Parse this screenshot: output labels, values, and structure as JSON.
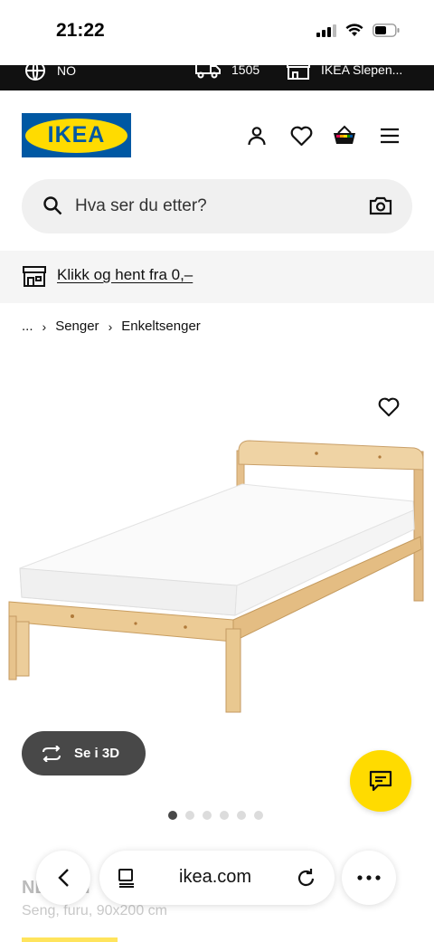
{
  "status_bar": {
    "time": "21:22"
  },
  "top_strip": {
    "items": [
      {
        "icon": "globe-icon",
        "label": "NO"
      },
      {
        "icon": "truck-icon",
        "label": "1505"
      },
      {
        "icon": "store-icon",
        "label": "IKEA Slepen..."
      }
    ]
  },
  "header": {
    "logo_text": "IKEA",
    "icons": [
      "user-icon",
      "heart-icon",
      "basket-icon",
      "menu-icon"
    ]
  },
  "search": {
    "placeholder": "Hva ser du etter?"
  },
  "promo": {
    "link_text": "Klikk og hent fra 0,–"
  },
  "breadcrumb": {
    "items": [
      "...",
      "Senger",
      "Enkeltsenger"
    ]
  },
  "product": {
    "view_3d_label": "Se i 3D",
    "image_count": 6,
    "active_image": 1,
    "title": "NEIDEN",
    "subtitle": "Seng, furu, 90x200 cm"
  },
  "browser": {
    "url": "ikea.com"
  },
  "colors": {
    "brand_blue": "#0058a3",
    "brand_yellow": "#ffdb00",
    "dark_gray": "#484848"
  }
}
